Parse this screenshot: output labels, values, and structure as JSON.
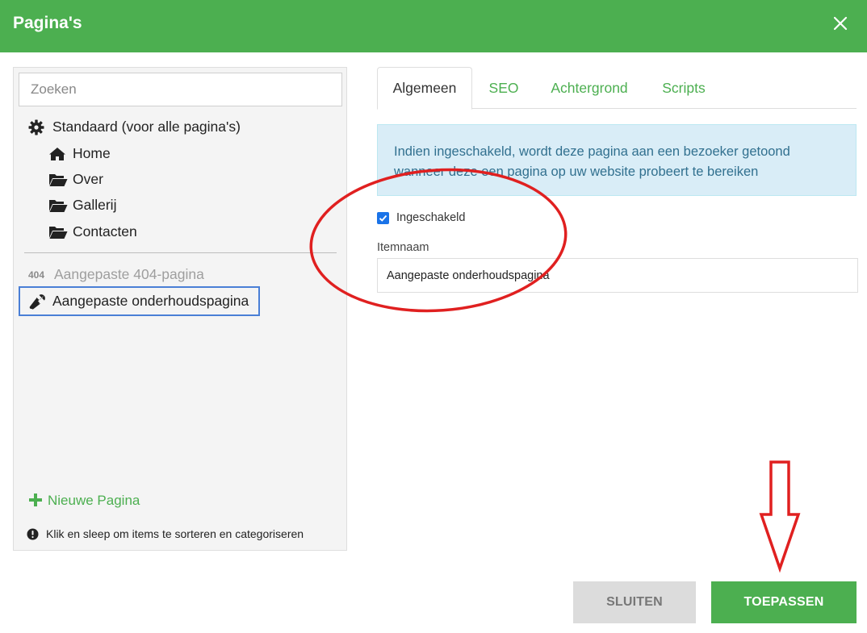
{
  "dialog": {
    "title": "Pagina's"
  },
  "search": {
    "placeholder": "Zoeken"
  },
  "tree": {
    "standard": "Standaard (voor alle pagina's)",
    "pages": [
      "Home",
      "Over",
      "Gallerij",
      "Contacten"
    ],
    "badge_404": "404",
    "page_404": "Aangepaste 404-pagina",
    "maintenance": "Aangepaste onderhoudspagina"
  },
  "sidebar_footer": {
    "new_page": "Nieuwe Pagina",
    "hint": "Klik en sleep om items te sorteren en categoriseren"
  },
  "tabs": [
    "Algemeen",
    "SEO",
    "Achtergrond",
    "Scripts"
  ],
  "active_tab": "Algemeen",
  "info": {
    "line1": "Indien ingeschakeld, wordt deze pagina aan een bezoeker getoond",
    "line2": "wanneer deze een pagina op uw website probeert te bereiken"
  },
  "form": {
    "enabled_label": "Ingeschakeld",
    "enabled": true,
    "item_name_label": "Itemnaam",
    "item_name_value": "Aangepaste onderhoudspagina"
  },
  "buttons": {
    "close": "SLUITEN",
    "apply": "TOEPASSEN"
  },
  "colors": {
    "brand_green": "#4caf50",
    "info_bg": "#d9edf7",
    "info_text": "#31708f",
    "annotation_red": "#e02020",
    "selection_blue": "#4a7fd6"
  }
}
